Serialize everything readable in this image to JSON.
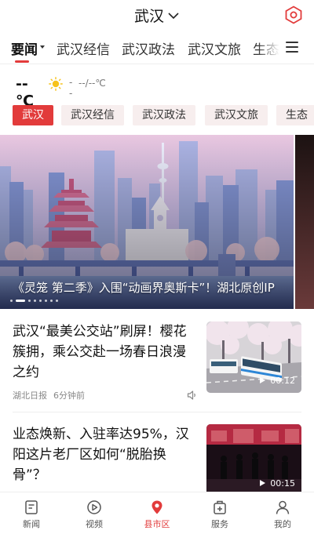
{
  "header": {
    "city": "武汉",
    "city_icon": "chevron-down-icon",
    "right_icon": "hexagon-icon",
    "accent": "#e23b3b"
  },
  "tabs": {
    "items": [
      "要闻",
      "武汉经信",
      "武汉政法",
      "武汉文旅",
      "生态"
    ],
    "active": "要闻",
    "menu_icon": "hamburger-menu-icon"
  },
  "weather": {
    "temp": "--℃",
    "icon": "sun-icon",
    "separator": "--",
    "range": "--/--℃"
  },
  "chips": {
    "items": [
      "武汉",
      "武汉经信",
      "武汉政法",
      "武汉文旅",
      "生态"
    ],
    "active": "武汉"
  },
  "banner": {
    "title": "《灵笼 第二季》入围“动画界奥斯卡”！湖北原创IP",
    "dot_count": 8,
    "active_dot": 1
  },
  "news": [
    {
      "title": "武汉“最美公交站”刷屏！樱花簇拥，乘公交赴一场春日浪漫之约",
      "source": "湖北日报",
      "time": "6分钟前",
      "audio_icon": "speaker-icon",
      "duration": "00:12"
    },
    {
      "title": "业态焕新、入驻率达95%，汉阳这片老厂区如何“脱胎换骨”？",
      "duration": "00:15"
    }
  ],
  "bottom_nav": {
    "items": [
      {
        "label": "新闻",
        "icon": "news-icon"
      },
      {
        "label": "视频",
        "icon": "video-play-icon"
      },
      {
        "label": "县市区",
        "icon": "location-pin-icon"
      },
      {
        "label": "服务",
        "icon": "service-box-icon"
      },
      {
        "label": "我的",
        "icon": "user-icon"
      }
    ],
    "active": "县市区"
  }
}
